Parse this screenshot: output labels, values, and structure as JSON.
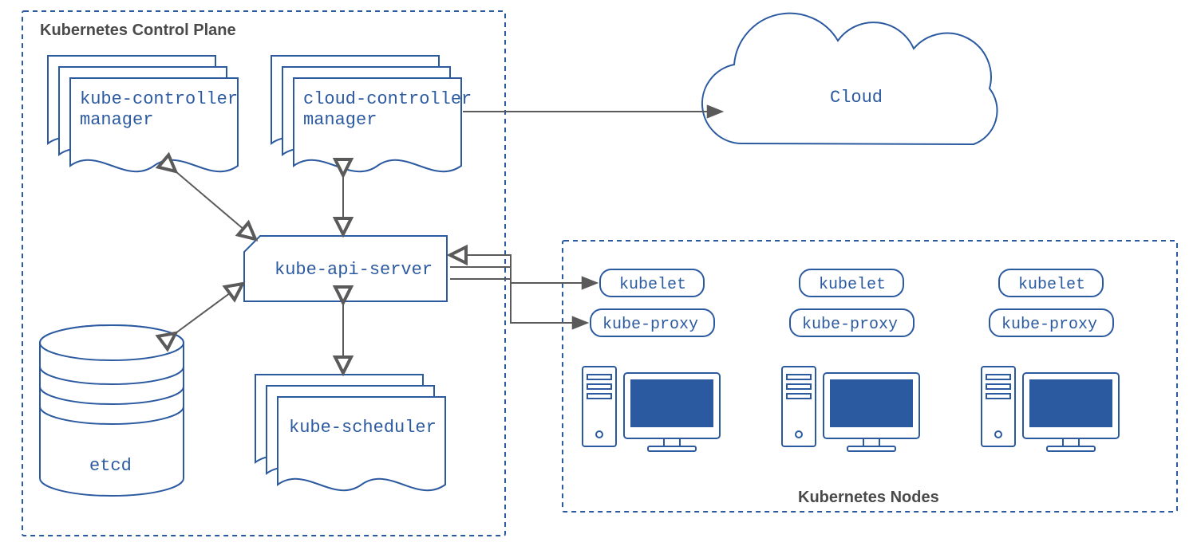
{
  "controlPlane": {
    "title": "Kubernetes Control Plane",
    "kubeControllerManager": "kube-controller\nmanager",
    "cloudControllerManager": "cloud-controller\nmanager",
    "kubeApiServer": "kube-api-server",
    "etcd": "etcd",
    "kubeScheduler": "kube-scheduler"
  },
  "cloud": {
    "label": "Cloud"
  },
  "nodes": {
    "title": "Kubernetes Nodes",
    "kubelet": "kubelet",
    "kubeProxy": "kube-proxy"
  }
}
